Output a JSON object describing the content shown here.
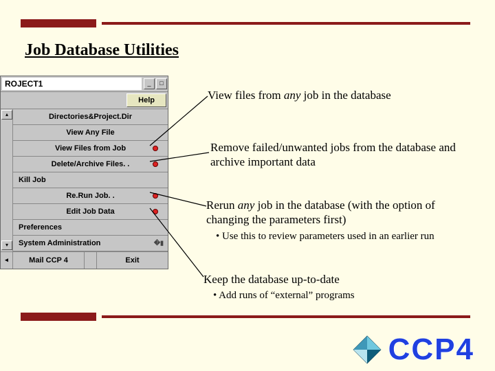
{
  "title": "Job Database Utilities",
  "menu": {
    "windowTitle": "ROJECT1",
    "help": "Help",
    "items": [
      "Directories&Project.Dir",
      "View Any File",
      "View Files from Job",
      "Delete/Archive Files. .",
      "Kill Job",
      "Re.Run Job. .",
      "Edit Job Data",
      "Preferences",
      "System Administration"
    ],
    "footer": {
      "mail": "Mail CCP 4",
      "exit": "Exit"
    }
  },
  "notes": {
    "n1": {
      "pre": "View files from ",
      "em": "any",
      "post": " job in the database"
    },
    "n2": "Remove failed/unwanted jobs from the database and archive important data",
    "n3": {
      "pre": "Rerun ",
      "em": "any",
      "post": " job in the database (with the option of changing the parameters first)"
    },
    "n3sub": "• Use this to review parameters used in an earlier run",
    "n4": "Keep the database up-to-date",
    "n4sub": "• Add runs of “external” programs"
  },
  "logo": "CCP4"
}
